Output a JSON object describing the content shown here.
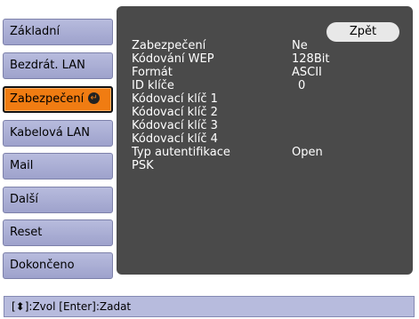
{
  "sidebar": {
    "items": [
      {
        "label": "Základní"
      },
      {
        "label": "Bezdrát. LAN"
      },
      {
        "label": "Zabezpečení"
      },
      {
        "label": "Kabelová LAN"
      },
      {
        "label": "Mail"
      },
      {
        "label": "Další"
      },
      {
        "label": "Reset"
      },
      {
        "label": "Dokončeno"
      }
    ],
    "selected_index": 2,
    "enter_icon": "enter-icon"
  },
  "panel": {
    "back_label": "Zpět",
    "rows": [
      {
        "label": "Zabezpečení",
        "value": "Ne"
      },
      {
        "label": "Kódování WEP",
        "value": "128Bit"
      },
      {
        "label": "Formát",
        "value": "ASCII"
      },
      {
        "label": "ID klíče",
        "value": "0"
      },
      {
        "label": "Kódovací klíč 1",
        "value": ""
      },
      {
        "label": "Kódovací klíč 2",
        "value": ""
      },
      {
        "label": "Kódovací klíč 3",
        "value": ""
      },
      {
        "label": "Kódovací klíč 4",
        "value": ""
      },
      {
        "label": "Typ autentifikace",
        "value": "Open"
      },
      {
        "label": "PSK",
        "value": ""
      }
    ]
  },
  "footer": {
    "text": "[⬍]:Zvol  [Enter]:Zadat"
  },
  "colors": {
    "menu_item": "#b7bbdd",
    "selected": "#f07c12",
    "panel": "#4a4a4a",
    "row_text": "#ffffff"
  }
}
